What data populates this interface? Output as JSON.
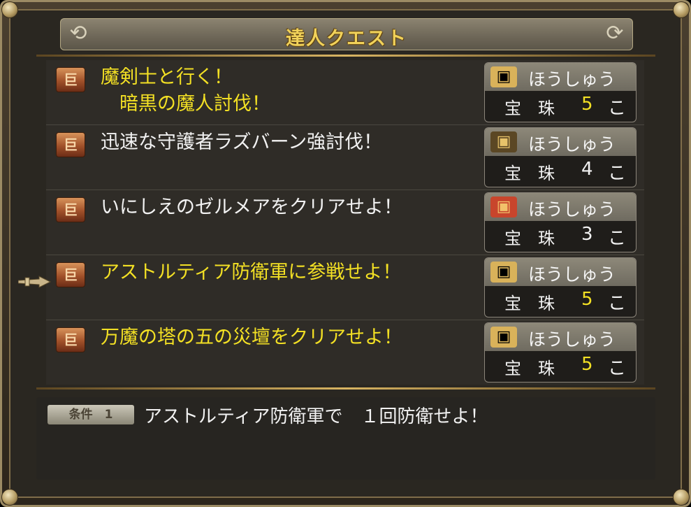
{
  "header": {
    "title": "達人クエスト"
  },
  "quests": [
    {
      "title": "魔剣士と行く！\n　暗黒の魔人討伐！",
      "title_color": "yellow",
      "reward": {
        "label": "ほうしゅう",
        "item": "宝　珠",
        "count": "5",
        "unit": "こ",
        "count_color": "yellow",
        "chest": "gold-chest-icon"
      }
    },
    {
      "title": "迅速な守護者ラズバーン強討伐！",
      "title_color": "white",
      "reward": {
        "label": "ほうしゅう",
        "item": "宝　珠",
        "count": "4",
        "unit": "こ",
        "count_color": "white",
        "chest": "dark-chest-icon"
      }
    },
    {
      "title": "いにしえのゼルメアをクリアせよ！",
      "title_color": "white",
      "reward": {
        "label": "ほうしゅう",
        "item": "宝　珠",
        "count": "3",
        "unit": "こ",
        "count_color": "white",
        "chest": "red-chest-icon"
      }
    },
    {
      "title": "アストルティア防衛軍に参戦せよ！",
      "title_color": "yellow",
      "reward": {
        "label": "ほうしゅう",
        "item": "宝　珠",
        "count": "5",
        "unit": "こ",
        "count_color": "yellow",
        "chest": "gold-chest-icon"
      }
    },
    {
      "title": "万魔の塔の五の災壇をクリアせよ！",
      "title_color": "yellow",
      "reward": {
        "label": "ほうしゅう",
        "item": "宝　珠",
        "count": "5",
        "unit": "こ",
        "count_color": "yellow",
        "chest": "gold-chest-icon"
      }
    }
  ],
  "condition": {
    "badge": "条件　1",
    "text": "アストルティア防衛軍で　１回防衛せよ！"
  },
  "colors": {
    "yellow": "#f3e024",
    "white": "#f2f2f2",
    "gold_chest": "#d9b25a",
    "dark_chest": "#5b4724",
    "red_chest": "#c8452c"
  }
}
